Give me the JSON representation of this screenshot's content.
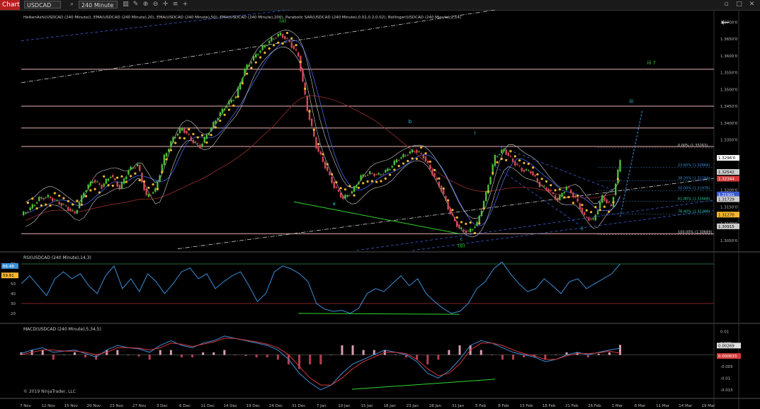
{
  "toolbar": {
    "chart_label": "Chart",
    "symbol": "USDCAD",
    "timeframe": "240 Minute",
    "icons": [
      "search-icon",
      "bar-type-icon",
      "pencil-icon",
      "zoom-in-icon",
      "zoom-out-icon",
      "crosshair-icon",
      "properties-icon",
      "add-icon"
    ],
    "right_icons": [
      "minimize-icon",
      "maximize-icon",
      "close-icon"
    ]
  },
  "colors": {
    "background": "#000000",
    "grid": "#1c1c1c",
    "up_candle": "#4fbf3a",
    "down_candle": "#d44a5a",
    "sar": "#f5b731",
    "ema20": "#3d5ccf",
    "ema200": "#8b2a2a",
    "bollinger": "#cfcfcf",
    "horizontal_level": "#e8b4b4",
    "wave_label_green": "#2ed62e",
    "wave_label_cyan": "#2ec7d6",
    "rsi": "#3d8fd6",
    "macd_line": "#3d8fd6",
    "macd_signal": "#d4383c"
  },
  "chart_data": [
    {
      "type": "candlestick",
      "panel": "price",
      "title": "HeikenAshi(USDCAD (240 Minute)), EMA(USDCAD (240 Minute),20), EMA(USDCAD (240 Minute),50), EMA(USDCAD (240 Minute),200), Parabolic SAR(USDCAD (240 Minute),0.02,0.2,0.02), Bollinger(USDCAD (240 Minute),2,14)",
      "y_ticks": [
        "1.3700'0",
        "1.3650'0",
        "1.3600'0",
        "1.3550'0",
        "1.3500'0",
        "1.3450'0",
        "1.3400'0",
        "1.3350'0",
        "1.3300'0",
        "1.3250'0",
        "1.3200'0",
        "1.3150'0",
        "1.3100'0",
        "1.3050'0"
      ],
      "y_tick_values": [
        1.37,
        1.365,
        1.36,
        1.355,
        1.35,
        1.345,
        1.34,
        1.335,
        1.33,
        1.325,
        1.32,
        1.315,
        1.31,
        1.305
      ],
      "ylim": [
        1.302,
        1.372
      ],
      "x_labels": [
        "7 Nov",
        "12 Nov",
        "15 Nov",
        "20 Nov",
        "23 Nov",
        "27 Nov",
        "3 Dec",
        "6 Dec",
        "11 Dec",
        "14 Dec",
        "19 Dec",
        "24 Dec",
        "31 Dec",
        "7 Jan",
        "10 Jan",
        "15 Jan",
        "18 Jan",
        "23 Jan",
        "28 Jan",
        "31 Jan",
        "5 Feb",
        "8 Feb",
        "13 Feb",
        "18 Feb",
        "21 Feb",
        "26 Feb",
        "1 Mar",
        "6 Mar",
        "11 Mar",
        "14 Mar",
        "19 Mar"
      ],
      "close_path": [
        [
          0,
          1.3125
        ],
        [
          4,
          1.3145
        ],
        [
          8,
          1.3175
        ],
        [
          12,
          1.318
        ],
        [
          16,
          1.3165
        ],
        [
          20,
          1.315
        ],
        [
          24,
          1.313
        ],
        [
          28,
          1.3195
        ],
        [
          32,
          1.323
        ],
        [
          36,
          1.321
        ],
        [
          40,
          1.3245
        ],
        [
          44,
          1.3205
        ],
        [
          48,
          1.326
        ],
        [
          52,
          1.3275
        ],
        [
          56,
          1.318
        ],
        [
          60,
          1.32
        ],
        [
          64,
          1.33
        ],
        [
          68,
          1.3355
        ],
        [
          72,
          1.3385
        ],
        [
          76,
          1.335
        ],
        [
          80,
          1.333
        ],
        [
          84,
          1.3375
        ],
        [
          88,
          1.342
        ],
        [
          92,
          1.3455
        ],
        [
          96,
          1.348
        ],
        [
          100,
          1.356
        ],
        [
          104,
          1.3595
        ],
        [
          108,
          1.3625
        ],
        [
          112,
          1.365
        ],
        [
          116,
          1.3665
        ],
        [
          120,
          1.364
        ],
        [
          124,
          1.36
        ],
        [
          128,
          1.344
        ],
        [
          132,
          1.333
        ],
        [
          136,
          1.327
        ],
        [
          140,
          1.321
        ],
        [
          144,
          1.3175
        ],
        [
          148,
          1.3195
        ],
        [
          152,
          1.324
        ],
        [
          156,
          1.325
        ],
        [
          160,
          1.3245
        ],
        [
          164,
          1.326
        ],
        [
          168,
          1.329
        ],
        [
          172,
          1.3305
        ],
        [
          176,
          1.332
        ],
        [
          180,
          1.33
        ],
        [
          184,
          1.325
        ],
        [
          188,
          1.32
        ],
        [
          192,
          1.313
        ],
        [
          196,
          1.3085
        ],
        [
          200,
          1.3075
        ],
        [
          204,
          1.31
        ],
        [
          208,
          1.319
        ],
        [
          212,
          1.33
        ],
        [
          216,
          1.332
        ],
        [
          220,
          1.3285
        ],
        [
          224,
          1.326
        ],
        [
          228,
          1.3255
        ],
        [
          232,
          1.3215
        ],
        [
          236,
          1.32
        ],
        [
          240,
          1.317
        ],
        [
          244,
          1.321
        ],
        [
          248,
          1.3175
        ],
        [
          252,
          1.312
        ],
        [
          256,
          1.311
        ],
        [
          260,
          1.318
        ],
        [
          264,
          1.315
        ],
        [
          268,
          1.329
        ]
      ],
      "horizontal_levels": [
        1.356,
        1.345,
        1.3385,
        1.333,
        1.307
      ],
      "fib_labels": [
        "0.00% (1.33263)",
        "23.60% (1.32666)",
        "38.20% (1.32284)",
        "50.00% (1.31976)",
        "61.80% (1.31668)",
        "76.40% (1.31286)",
        "100.00% (1.30669)"
      ],
      "fib_values": [
        1.3326,
        1.3267,
        1.3228,
        1.3198,
        1.3167,
        1.3129,
        1.3067
      ],
      "price_markers": [
        {
          "value": 1.3296,
          "label": "1.3296'0",
          "color": "#ffffff",
          "text": "#000000"
        },
        {
          "value": 1.3254,
          "label": "1.32542",
          "color": "#cccccc",
          "text": "#000000"
        },
        {
          "value": 1.3234,
          "label": "1.32344",
          "color": "#d43a3a",
          "text": "#ffffff"
        },
        {
          "value": 1.3187,
          "label": "1.31901",
          "color": "#3d5ccf",
          "text": "#ffffff"
        },
        {
          "value": 1.3173,
          "label": "1.31729",
          "color": "#cccccc",
          "text": "#000000"
        },
        {
          "value": 1.3127,
          "label": "1.31270",
          "color": "#f5b731",
          "text": "#000000"
        },
        {
          "value": 1.3092,
          "label": "1.30915",
          "color": "#cccccc",
          "text": "#000000"
        }
      ],
      "wave_labels": [
        {
          "text": "(a)",
          "x": 117,
          "y": 1.37,
          "color": "#2ed62e"
        },
        {
          "text": "a",
          "x": 140,
          "y": 1.3155,
          "color": "#2ec7d6"
        },
        {
          "text": "b",
          "x": 174,
          "y": 1.34,
          "color": "#2ec7d6"
        },
        {
          "text": "c",
          "x": 197,
          "y": 1.305,
          "color": "#2ec7d6"
        },
        {
          "text": "(b)",
          "x": 197,
          "y": 1.303,
          "color": "#2ed62e"
        },
        {
          "text": "i",
          "x": 203,
          "y": 1.3365,
          "color": "#2ec7d6"
        },
        {
          "text": "ii",
          "x": 251,
          "y": 1.308,
          "color": "#2ec7d6"
        },
        {
          "text": "iii",
          "x": 273,
          "y": 1.346,
          "color": "#2ec7d6"
        },
        {
          "text": "iii ?",
          "x": 282,
          "y": 1.3575,
          "color": "#2ed62e"
        }
      ]
    },
    {
      "type": "line",
      "panel": "rsi",
      "title": "RSI(USDCAD (240 Minute),14,3)",
      "y_ticks": [
        "70",
        "60",
        "50",
        "40",
        "30",
        "20"
      ],
      "y_tick_values": [
        70,
        60,
        50,
        40,
        30,
        20
      ],
      "ylim": [
        12,
        80
      ],
      "levels": [
        70,
        30
      ],
      "value_badges": [
        {
          "label": "66.48",
          "value": 66.48
        },
        {
          "label": "59.81",
          "value": 59.81
        }
      ],
      "series": [
        {
          "values": [
            50,
            58,
            48,
            38,
            55,
            62,
            55,
            60,
            48,
            40,
            58,
            68,
            45,
            55,
            42,
            60,
            52,
            40,
            50,
            62,
            66,
            55,
            60,
            45,
            52,
            58,
            62,
            48,
            32,
            40,
            62,
            68,
            65,
            60,
            52,
            30,
            24,
            22,
            23,
            20,
            25,
            40,
            45,
            42,
            50,
            58,
            48,
            55,
            40,
            32,
            25,
            20,
            22,
            30,
            45,
            52,
            65,
            72,
            60,
            50,
            42,
            45,
            55,
            48,
            40,
            52,
            55,
            45,
            50,
            55,
            60,
            70
          ]
        }
      ]
    },
    {
      "type": "line",
      "panel": "macd",
      "title": "MACD(USDCAD (240 Minute),5,34,5)",
      "y_ticks": [
        "0.01",
        "0.005",
        "0",
        "-0.005",
        "-0.01",
        "-0.015"
      ],
      "y_tick_values": [
        0.01,
        0.005,
        0,
        -0.005,
        -0.01,
        -0.015
      ],
      "ylim": [
        -0.0175,
        0.0125
      ],
      "value_badges": [
        {
          "label": "0.00269",
          "value": 0.00269
        },
        {
          "label": "0.000633",
          "value": 0.000633
        }
      ],
      "series": [
        {
          "values": [
            0.0005,
            0.002,
            0.003,
            0.001,
            0.0015,
            0.002,
            0.0005,
            -0.001,
            0.002,
            0.004,
            0.003,
            0.0025,
            0.001,
            0.004,
            0.006,
            0.004,
            0.003,
            0.005,
            0.006,
            0.008,
            0.007,
            0.006,
            0.005,
            0.004,
            0.002,
            -0.002,
            -0.008,
            -0.012,
            -0.015,
            -0.013,
            -0.008,
            -0.004,
            -0.002,
            0.0,
            0.002,
            0.001,
            0.0,
            -0.003,
            -0.008,
            -0.01,
            -0.007,
            -0.002,
            0.004,
            0.006,
            0.005,
            0.003,
            0.001,
            0.0,
            -0.001,
            -0.003,
            -0.002,
            0.0,
            0.001,
            0.0,
            0.001,
            0.002,
            0.0027
          ]
        },
        {
          "values": [
            0.0,
            0.001,
            0.002,
            0.002,
            0.0015,
            0.0015,
            0.001,
            0.0,
            0.001,
            0.003,
            0.003,
            0.0028,
            0.002,
            0.003,
            0.005,
            0.0045,
            0.0035,
            0.0045,
            0.0055,
            0.007,
            0.007,
            0.0062,
            0.0055,
            0.0045,
            0.003,
            0.0,
            -0.005,
            -0.01,
            -0.013,
            -0.013,
            -0.01,
            -0.006,
            -0.003,
            -0.001,
            0.001,
            0.001,
            0.0005,
            -0.002,
            -0.006,
            -0.009,
            -0.008,
            -0.004,
            0.002,
            0.005,
            0.005,
            0.004,
            0.002,
            0.0005,
            -0.0005,
            -0.002,
            -0.002,
            -0.0005,
            0.0005,
            0.0005,
            0.0008,
            0.0015,
            0.0006
          ]
        }
      ]
    }
  ],
  "footer": {
    "copyright": "© 2019 NinjaTrader, LLC"
  }
}
